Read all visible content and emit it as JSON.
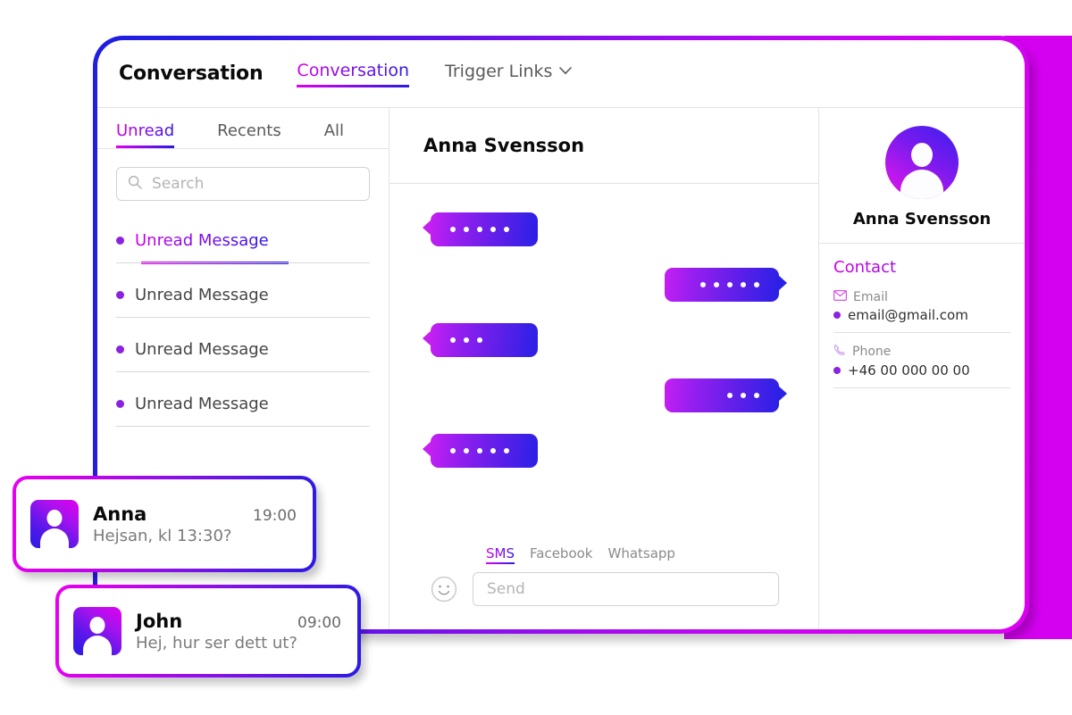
{
  "window": {
    "title": "Conversation"
  },
  "topnav": {
    "items": [
      {
        "label": "Conversation",
        "active": true
      },
      {
        "label": "Trigger Links",
        "active": false,
        "icon": "chevron-down-icon"
      }
    ]
  },
  "sidebar": {
    "filters": [
      {
        "label": "Unread",
        "active": true
      },
      {
        "label": "Recents",
        "active": false
      },
      {
        "label": "All",
        "active": false
      }
    ],
    "search": {
      "placeholder": "Search",
      "value": "",
      "icon": "search-icon"
    },
    "threads": [
      {
        "label": "Unread Message",
        "active": true
      },
      {
        "label": "Unread Message",
        "active": false
      },
      {
        "label": "Unread Message",
        "active": false
      },
      {
        "label": "Unread Message",
        "active": false
      }
    ]
  },
  "chat": {
    "title": "Anna Svensson",
    "messages": [
      {
        "direction": "in",
        "dots": 5
      },
      {
        "direction": "out",
        "dots": 5
      },
      {
        "direction": "in",
        "dots": 3
      },
      {
        "direction": "out",
        "dots": 3
      },
      {
        "direction": "in",
        "dots": 5
      }
    ],
    "composer": {
      "channels": [
        {
          "label": "SMS",
          "active": true
        },
        {
          "label": "Facebook",
          "active": false
        },
        {
          "label": "Whatsapp",
          "active": false
        }
      ],
      "emoji_icon": "smiley-icon",
      "input": {
        "placeholder": "Send",
        "value": ""
      }
    }
  },
  "contact": {
    "avatar_icon": "user-avatar-icon",
    "name": "Anna Svensson",
    "heading": "Contact",
    "fields": [
      {
        "label": "Email",
        "icon": "envelope-icon",
        "value": "email@gmail.com"
      },
      {
        "label": "Phone",
        "icon": "phone-icon",
        "value": "+46 00 000 00 00"
      }
    ]
  },
  "notifications": [
    {
      "avatar_icon": "user-avatar-icon",
      "name": "Anna",
      "time": "19:00",
      "preview": "Hejsan, kl 13:30?"
    },
    {
      "avatar_icon": "user-avatar-icon",
      "name": "John",
      "time": "09:00",
      "preview": "Hej, hur ser dett ut?"
    }
  ],
  "colors": {
    "accent_magenta": "#d400f0",
    "accent_blue": "#2a1ae4",
    "bullet_purple": "#8b22e0",
    "text_dark": "#0a0a0a",
    "text_muted": "#7a7a7a"
  }
}
